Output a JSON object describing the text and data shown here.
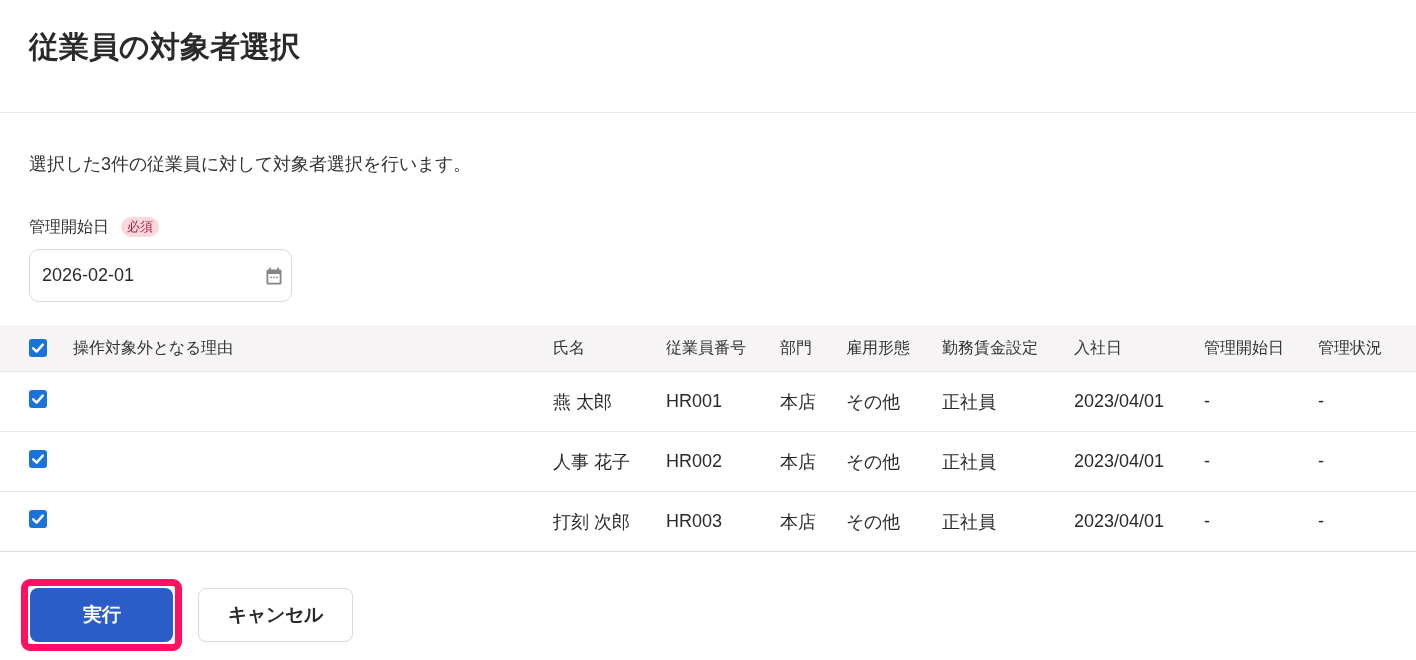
{
  "header": {
    "title": "従業員の対象者選択"
  },
  "description": "選択した3件の従業員に対して対象者選択を行います。",
  "field": {
    "label": "管理開始日",
    "badge": "必須",
    "value": "2026-02-01"
  },
  "table": {
    "all_checked": true,
    "columns": [
      "操作対象外となる理由",
      "氏名",
      "従業員番号",
      "部門",
      "雇用形態",
      "勤務賃金設定",
      "入社日",
      "管理開始日",
      "管理状況"
    ],
    "rows": [
      {
        "checked": true,
        "cells": [
          "",
          "燕 太郎",
          "HR001",
          "本店",
          "その他",
          "正社員",
          "2023/04/01",
          "-",
          "-"
        ]
      },
      {
        "checked": true,
        "cells": [
          "",
          "人事 花子",
          "HR002",
          "本店",
          "その他",
          "正社員",
          "2023/04/01",
          "-",
          "-"
        ]
      },
      {
        "checked": true,
        "cells": [
          "",
          "打刻 次郎",
          "HR003",
          "本店",
          "その他",
          "正社員",
          "2023/04/01",
          "-",
          "-"
        ]
      }
    ]
  },
  "buttons": [
    {
      "kind": "primary",
      "label": "実行",
      "highlighted": true
    },
    {
      "kind": "secondary",
      "label": "キャンセル",
      "highlighted": false
    }
  ]
}
